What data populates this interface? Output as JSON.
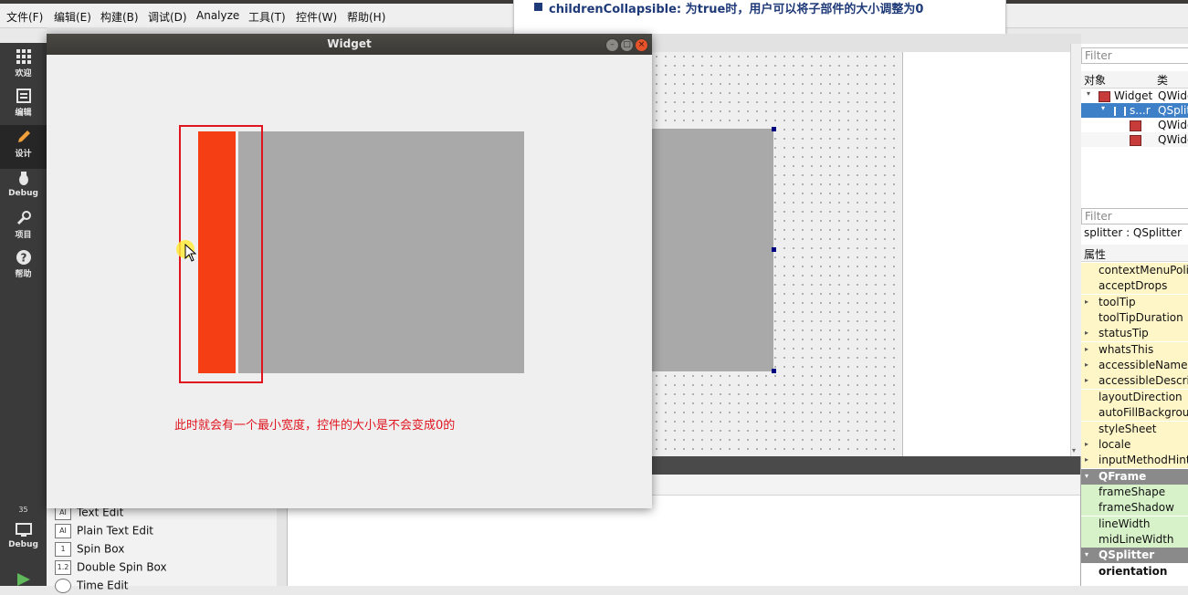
{
  "menubar": {
    "items": [
      "文件(F)",
      "编辑(E)",
      "构建(B)",
      "调试(D)",
      "Analyze",
      "工具(T)",
      "控件(W)",
      "帮助(H)"
    ]
  },
  "doc_popup": {
    "text": "childrenCollapsible: 为true时，用户可以将子部件的大小调整为0"
  },
  "modes": [
    {
      "label": "欢迎",
      "icon": "grid-icon"
    },
    {
      "label": "编辑",
      "icon": "edit-doc-icon"
    },
    {
      "label": "设计",
      "icon": "pencil-icon",
      "active": true
    },
    {
      "label": "Debug",
      "icon": "bug-icon"
    },
    {
      "label": "项目",
      "icon": "wrench-icon"
    },
    {
      "label": "帮助",
      "icon": "help-icon"
    }
  ],
  "mode_bottom": {
    "number": "35",
    "label": "Debug"
  },
  "window": {
    "title": "Widget",
    "annotation": "此时就会有一个最小宽度，控件的大小是不会变成0的"
  },
  "widget_box": {
    "items": [
      {
        "label": "Text Edit",
        "icon": "AI"
      },
      {
        "label": "Plain Text Edit",
        "icon": "AI"
      },
      {
        "label": "Spin Box",
        "icon": "1"
      },
      {
        "label": "Double Spin Box",
        "icon": "1.2"
      },
      {
        "label": "Time Edit",
        "icon": "clock"
      }
    ]
  },
  "object_inspector": {
    "filter_placeholder": "Filter",
    "col_object": "对象",
    "col_class": "类",
    "rows": [
      {
        "name": "Widget",
        "cls": "QWidg"
      },
      {
        "name": "s...r",
        "cls": "QSplit"
      },
      {
        "name": "",
        "cls": "QWidg"
      },
      {
        "name": "",
        "cls": "QWidg"
      }
    ]
  },
  "property_editor": {
    "filter_placeholder": "Filter",
    "object_line": "splitter : QSplitter",
    "header": "属性",
    "props": [
      {
        "name": "contextMenuPolicy",
        "kind": "y",
        "expand": false
      },
      {
        "name": "acceptDrops",
        "kind": "y",
        "expand": false
      },
      {
        "name": "toolTip",
        "kind": "y",
        "expand": true
      },
      {
        "name": "toolTipDuration",
        "kind": "y",
        "expand": false
      },
      {
        "name": "statusTip",
        "kind": "y",
        "expand": true
      },
      {
        "name": "whatsThis",
        "kind": "y",
        "expand": true
      },
      {
        "name": "accessibleName",
        "kind": "y",
        "expand": true
      },
      {
        "name": "accessibleDescription",
        "kind": "y",
        "expand": true
      },
      {
        "name": "layoutDirection",
        "kind": "y",
        "expand": false
      },
      {
        "name": "autoFillBackground",
        "kind": "y",
        "expand": false
      },
      {
        "name": "styleSheet",
        "kind": "y",
        "expand": false
      },
      {
        "name": "locale",
        "kind": "y",
        "expand": true
      },
      {
        "name": "inputMethodHints",
        "kind": "y",
        "expand": true
      },
      {
        "name": "QFrame",
        "kind": "sec",
        "expand": true
      },
      {
        "name": "frameShape",
        "kind": "g",
        "expand": false
      },
      {
        "name": "frameShadow",
        "kind": "g",
        "expand": false
      },
      {
        "name": "lineWidth",
        "kind": "g",
        "expand": false
      },
      {
        "name": "midLineWidth",
        "kind": "g",
        "expand": false
      },
      {
        "name": "QSplitter",
        "kind": "sec",
        "expand": true
      },
      {
        "name": "orientation",
        "kind": "b",
        "expand": false
      }
    ]
  }
}
